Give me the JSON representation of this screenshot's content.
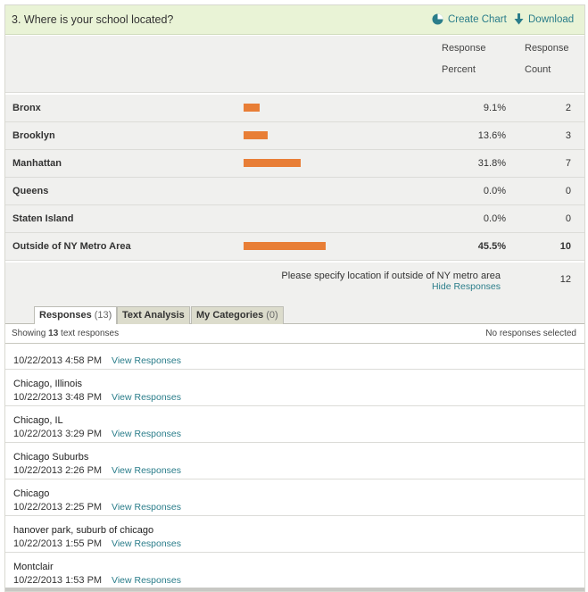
{
  "question": {
    "title": "3. Where is your school located?",
    "create_chart": "Create Chart",
    "download": "Download"
  },
  "columns": {
    "percent_line1": "Response",
    "percent_line2": "Percent",
    "count_line1": "Response",
    "count_line2": "Count"
  },
  "answers": [
    {
      "label": "Bronx",
      "percent_text": "9.1%",
      "percent": 9.1,
      "count": "2"
    },
    {
      "label": "Brooklyn",
      "percent_text": "13.6%",
      "percent": 13.6,
      "count": "3"
    },
    {
      "label": "Manhattan",
      "percent_text": "31.8%",
      "percent": 31.8,
      "count": "7"
    },
    {
      "label": "Queens",
      "percent_text": "0.0%",
      "percent": 0.0,
      "count": "0"
    },
    {
      "label": "Staten Island",
      "percent_text": "0.0%",
      "percent": 0.0,
      "count": "0"
    },
    {
      "label": "Outside of NY Metro Area",
      "percent_text": "45.5%",
      "percent": 45.5,
      "count": "10"
    }
  ],
  "other": {
    "text": "Please specify location if outside of NY metro area",
    "hide_link": "Hide Responses",
    "count": "12"
  },
  "tabs": [
    {
      "label": "Responses",
      "count": "(13)"
    },
    {
      "label": "Text Analysis",
      "count": ""
    },
    {
      "label": "My Categories",
      "count": "(0)"
    }
  ],
  "responses_bar": {
    "showing_prefix": "Showing ",
    "showing_count": "13",
    "showing_suffix": " text responses",
    "selection": "No responses selected"
  },
  "view_label": "View Responses",
  "responses": [
    {
      "text": "",
      "date": "10/22/2013 4:58 PM"
    },
    {
      "text": "Chicago, Illinois",
      "date": "10/22/2013 3:48 PM"
    },
    {
      "text": "Chicago, IL",
      "date": "10/22/2013 3:29 PM"
    },
    {
      "text": "Chicago Suburbs",
      "date": "10/22/2013 2:26 PM"
    },
    {
      "text": "Chicago",
      "date": "10/22/2013 2:25 PM"
    },
    {
      "text": "hanover park, suburb of chicago",
      "date": "10/22/2013 1:55 PM"
    },
    {
      "text": "Montclair",
      "date": "10/22/2013 1:53 PM"
    }
  ],
  "colors": {
    "bar": "#e87e36",
    "header_bg": "#e9f3d6",
    "link": "#2a7d8a"
  }
}
